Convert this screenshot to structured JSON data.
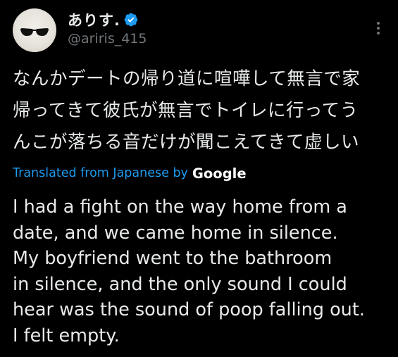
{
  "author": {
    "display_name": "ありす.",
    "handle": "@ariris_415",
    "verified": true
  },
  "icons": {
    "verified": "verified-badge-icon",
    "more": "more-options-icon",
    "avatar": "avatar-sunglasses"
  },
  "colors": {
    "background": "#000000",
    "text": "#e7e9ea",
    "secondary": "#71767b",
    "accent": "#1d9bf0"
  },
  "tweet": {
    "original_lines": [
      "なんかデートの帰り道に喧嘩して無言で家",
      "帰ってきて彼氏が無言でトイレに行ってう",
      "んこが落ちる音だけが聞こえてきて虚しい"
    ],
    "translation_notice": "Translated from Japanese by",
    "translation_provider": "Google",
    "translated_lines": [
      "I had a fight on the way home from a",
      "date, and we came home in silence.",
      "My boyfriend went to the bathroom",
      "in silence, and the only sound I could",
      "hear was the sound of poop falling out.",
      "I felt empty."
    ]
  }
}
